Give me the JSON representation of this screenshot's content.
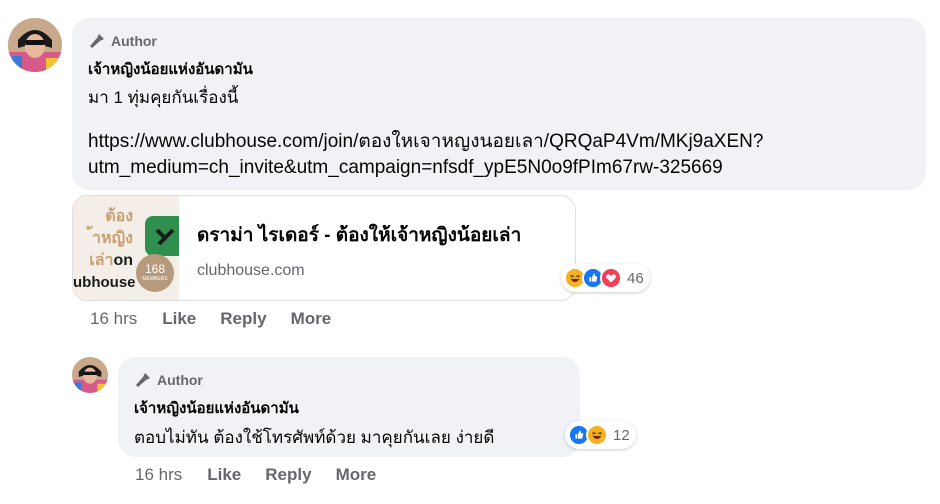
{
  "comments": [
    {
      "author_badge": "Author",
      "author_name": "เจ้าหญิงน้อยแห่งอันดามัน",
      "text": "มา 1 ทุ่มคุยกันเรื่องนี้",
      "link_line1": "https://www.clubhouse.com/join/ตองใหเจาหญงนอยเลา/QRQaP4Vm/MKj9aXEN?",
      "link_line2": "utm_medium=ch_invite&utm_campaign=nfsdf_ypE5N0o9fPIm67rw-325669",
      "preview": {
        "thumb_line1": "ต้อง",
        "thumb_line2": "้าหญิง",
        "thumb_line3": "เล่า",
        "thumb_on": "on",
        "thumb_brand": "ubhouse",
        "thumb_count": "168",
        "thumb_count_label": "MEMBERS",
        "title": "ดราม่า ไรเดอร์ - ต้องให้เจ้าหญิงน้อยเล่า",
        "domain": "clubhouse.com"
      },
      "reactions": {
        "count": "46",
        "icons": [
          "haha-icon",
          "like-icon",
          "love-icon"
        ]
      },
      "time": "16 hrs",
      "like_label": "Like",
      "reply_label": "Reply",
      "more_label": "More"
    },
    {
      "author_badge": "Author",
      "author_name": "เจ้าหญิงน้อยแห่งอันดามัน",
      "text": "ตอบไม่ทัน ต้องใช้โทรศัพท์ด้วย มาคุยกันเลย ง่ายดี",
      "reactions": {
        "count": "12",
        "icons": [
          "like-icon",
          "haha-icon"
        ]
      },
      "time": "16 hrs",
      "like_label": "Like",
      "reply_label": "Reply",
      "more_label": "More"
    }
  ],
  "colors": {
    "bubble": "#f0f2f5",
    "secondary_text": "#65676b",
    "like_blue": "#1877f2",
    "love_red": "#f33e58",
    "haha_yellow": "#f7b125",
    "thumb_green": "#2f8f4e"
  }
}
